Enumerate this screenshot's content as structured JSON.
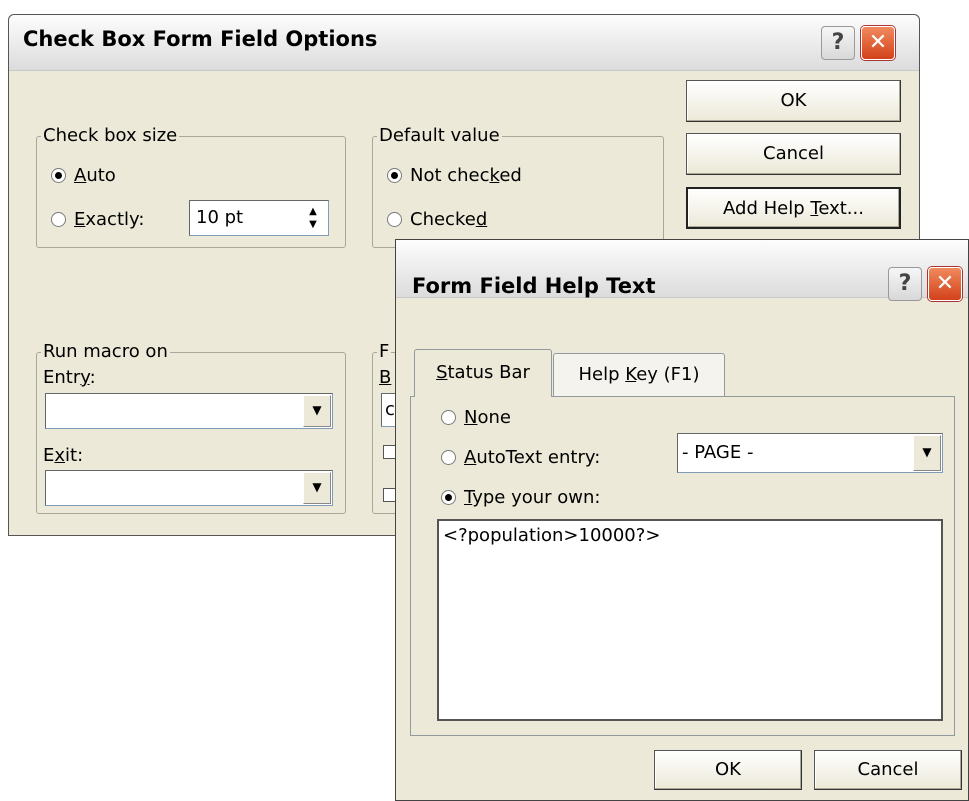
{
  "options_dialog": {
    "title": "Check Box Form Field Options",
    "help_glyph": "?",
    "close_glyph": "✕",
    "ok_label": "OK",
    "cancel_label": "Cancel",
    "add_help_text_label_pre": "Add Help ",
    "add_help_text_label_key": "T",
    "add_help_text_label_post": "ext...",
    "check_box_size": {
      "legend": "Check box size",
      "auto_key": "A",
      "auto_rest": "uto",
      "exactly_key": "E",
      "exactly_rest": "xactly:",
      "size_value": "10 pt",
      "selected": "auto"
    },
    "default_value": {
      "legend": "Default value",
      "not_checked_pre": "Not chec",
      "not_checked_key": "k",
      "not_checked_post": "ed",
      "checked_pre": "Checke",
      "checked_key": "d",
      "selected": "not_checked"
    },
    "run_macro": {
      "legend": "Run macro on",
      "entry_pre": "Entr",
      "entry_key": "y",
      "entry_post": ":",
      "entry_value": "",
      "exit_pre": "E",
      "exit_key": "x",
      "exit_post": "it:",
      "exit_value": ""
    },
    "field_settings_partial": {
      "legend_initial": "F",
      "label_initial": "B",
      "field_initial": "c"
    }
  },
  "help_dialog": {
    "title": "Form Field Help Text",
    "help_glyph": "?",
    "close_glyph": "✕",
    "tabs": [
      {
        "key": "S",
        "rest": "tatus Bar",
        "active": true
      },
      {
        "pre": "Help ",
        "key": "K",
        "rest": "ey (F1)",
        "active": false
      }
    ],
    "none_key": "N",
    "none_rest": "one",
    "autotext_key": "A",
    "autotext_rest": "utoText entry:",
    "autotext_value": "- PAGE -",
    "type_own_key": "T",
    "type_own_rest": "ype your own:",
    "selected": "type_your_own",
    "help_text": "<?population>10000?>",
    "ok_label": "OK",
    "cancel_label": "Cancel"
  }
}
